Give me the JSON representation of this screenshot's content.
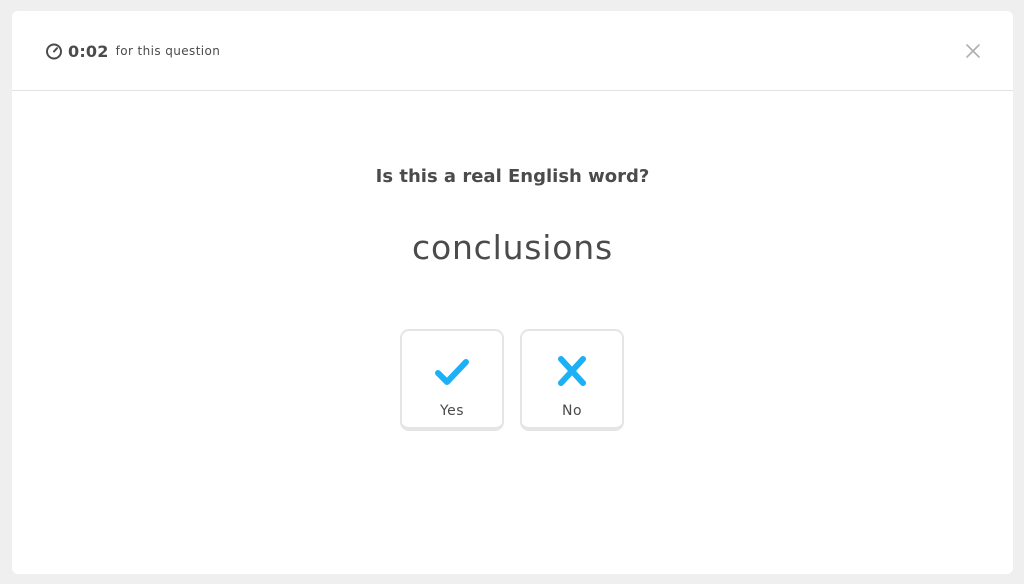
{
  "header": {
    "timer_icon": "stopwatch-icon",
    "timer_value": "0:02",
    "timer_suffix": "for this question",
    "close_icon": "close-icon"
  },
  "question": {
    "prompt": "Is this a real English word?",
    "word": "conclusions"
  },
  "choices": [
    {
      "label": "Yes",
      "icon": "checkmark-icon"
    },
    {
      "label": "No",
      "icon": "x-mark-icon"
    }
  ],
  "colors": {
    "accent": "#1cb0f6",
    "text": "#4b4b4b",
    "muted_icon": "#afafaf",
    "border": "#e5e5e5",
    "background": "#efefef",
    "card": "#ffffff"
  }
}
